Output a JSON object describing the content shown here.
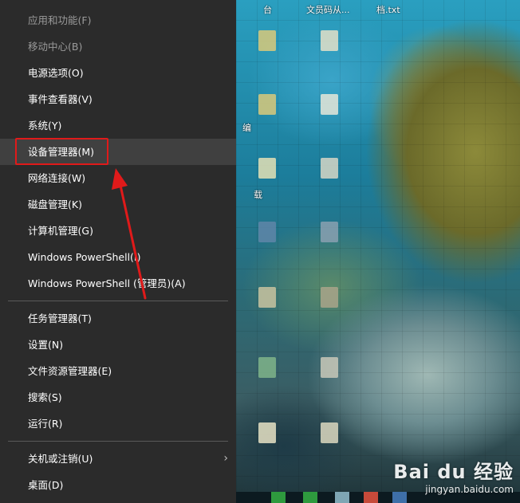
{
  "menu": {
    "items_group1": [
      {
        "label": "应用和功能(F)",
        "dim": true
      },
      {
        "label": "移动中心(B)",
        "dim": true
      },
      {
        "label": "电源选项(O)"
      },
      {
        "label": "事件查看器(V)"
      },
      {
        "label": "系统(Y)"
      },
      {
        "label": "设备管理器(M)",
        "highlighted": true
      },
      {
        "label": "网络连接(W)"
      },
      {
        "label": "磁盘管理(K)"
      },
      {
        "label": "计算机管理(G)"
      },
      {
        "label": "Windows PowerShell(I)"
      },
      {
        "label": "Windows PowerShell (管理员)(A)"
      }
    ],
    "items_group2": [
      {
        "label": "任务管理器(T)"
      },
      {
        "label": "设置(N)"
      },
      {
        "label": "文件资源管理器(E)"
      },
      {
        "label": "搜索(S)"
      },
      {
        "label": "运行(R)"
      }
    ],
    "items_group3": [
      {
        "label": "关机或注销(U)",
        "submenu_icon": "chevron-right-icon"
      },
      {
        "label": "桌面(D)"
      }
    ],
    "submenu_arrow_glyph": "›",
    "colors": {
      "background": "#2b2b2b",
      "highlight": "#404040",
      "text": "#ffffff",
      "annotation_red": "#e01a1a"
    }
  },
  "desktop": {
    "captions": {
      "top1": "台",
      "top2": "文员码从...",
      "top3": "档.txt",
      "left1": "编",
      "left2": "载"
    }
  },
  "watermark": {
    "brand": "Bai du 经验",
    "url": "jingyan.baidu.com"
  }
}
